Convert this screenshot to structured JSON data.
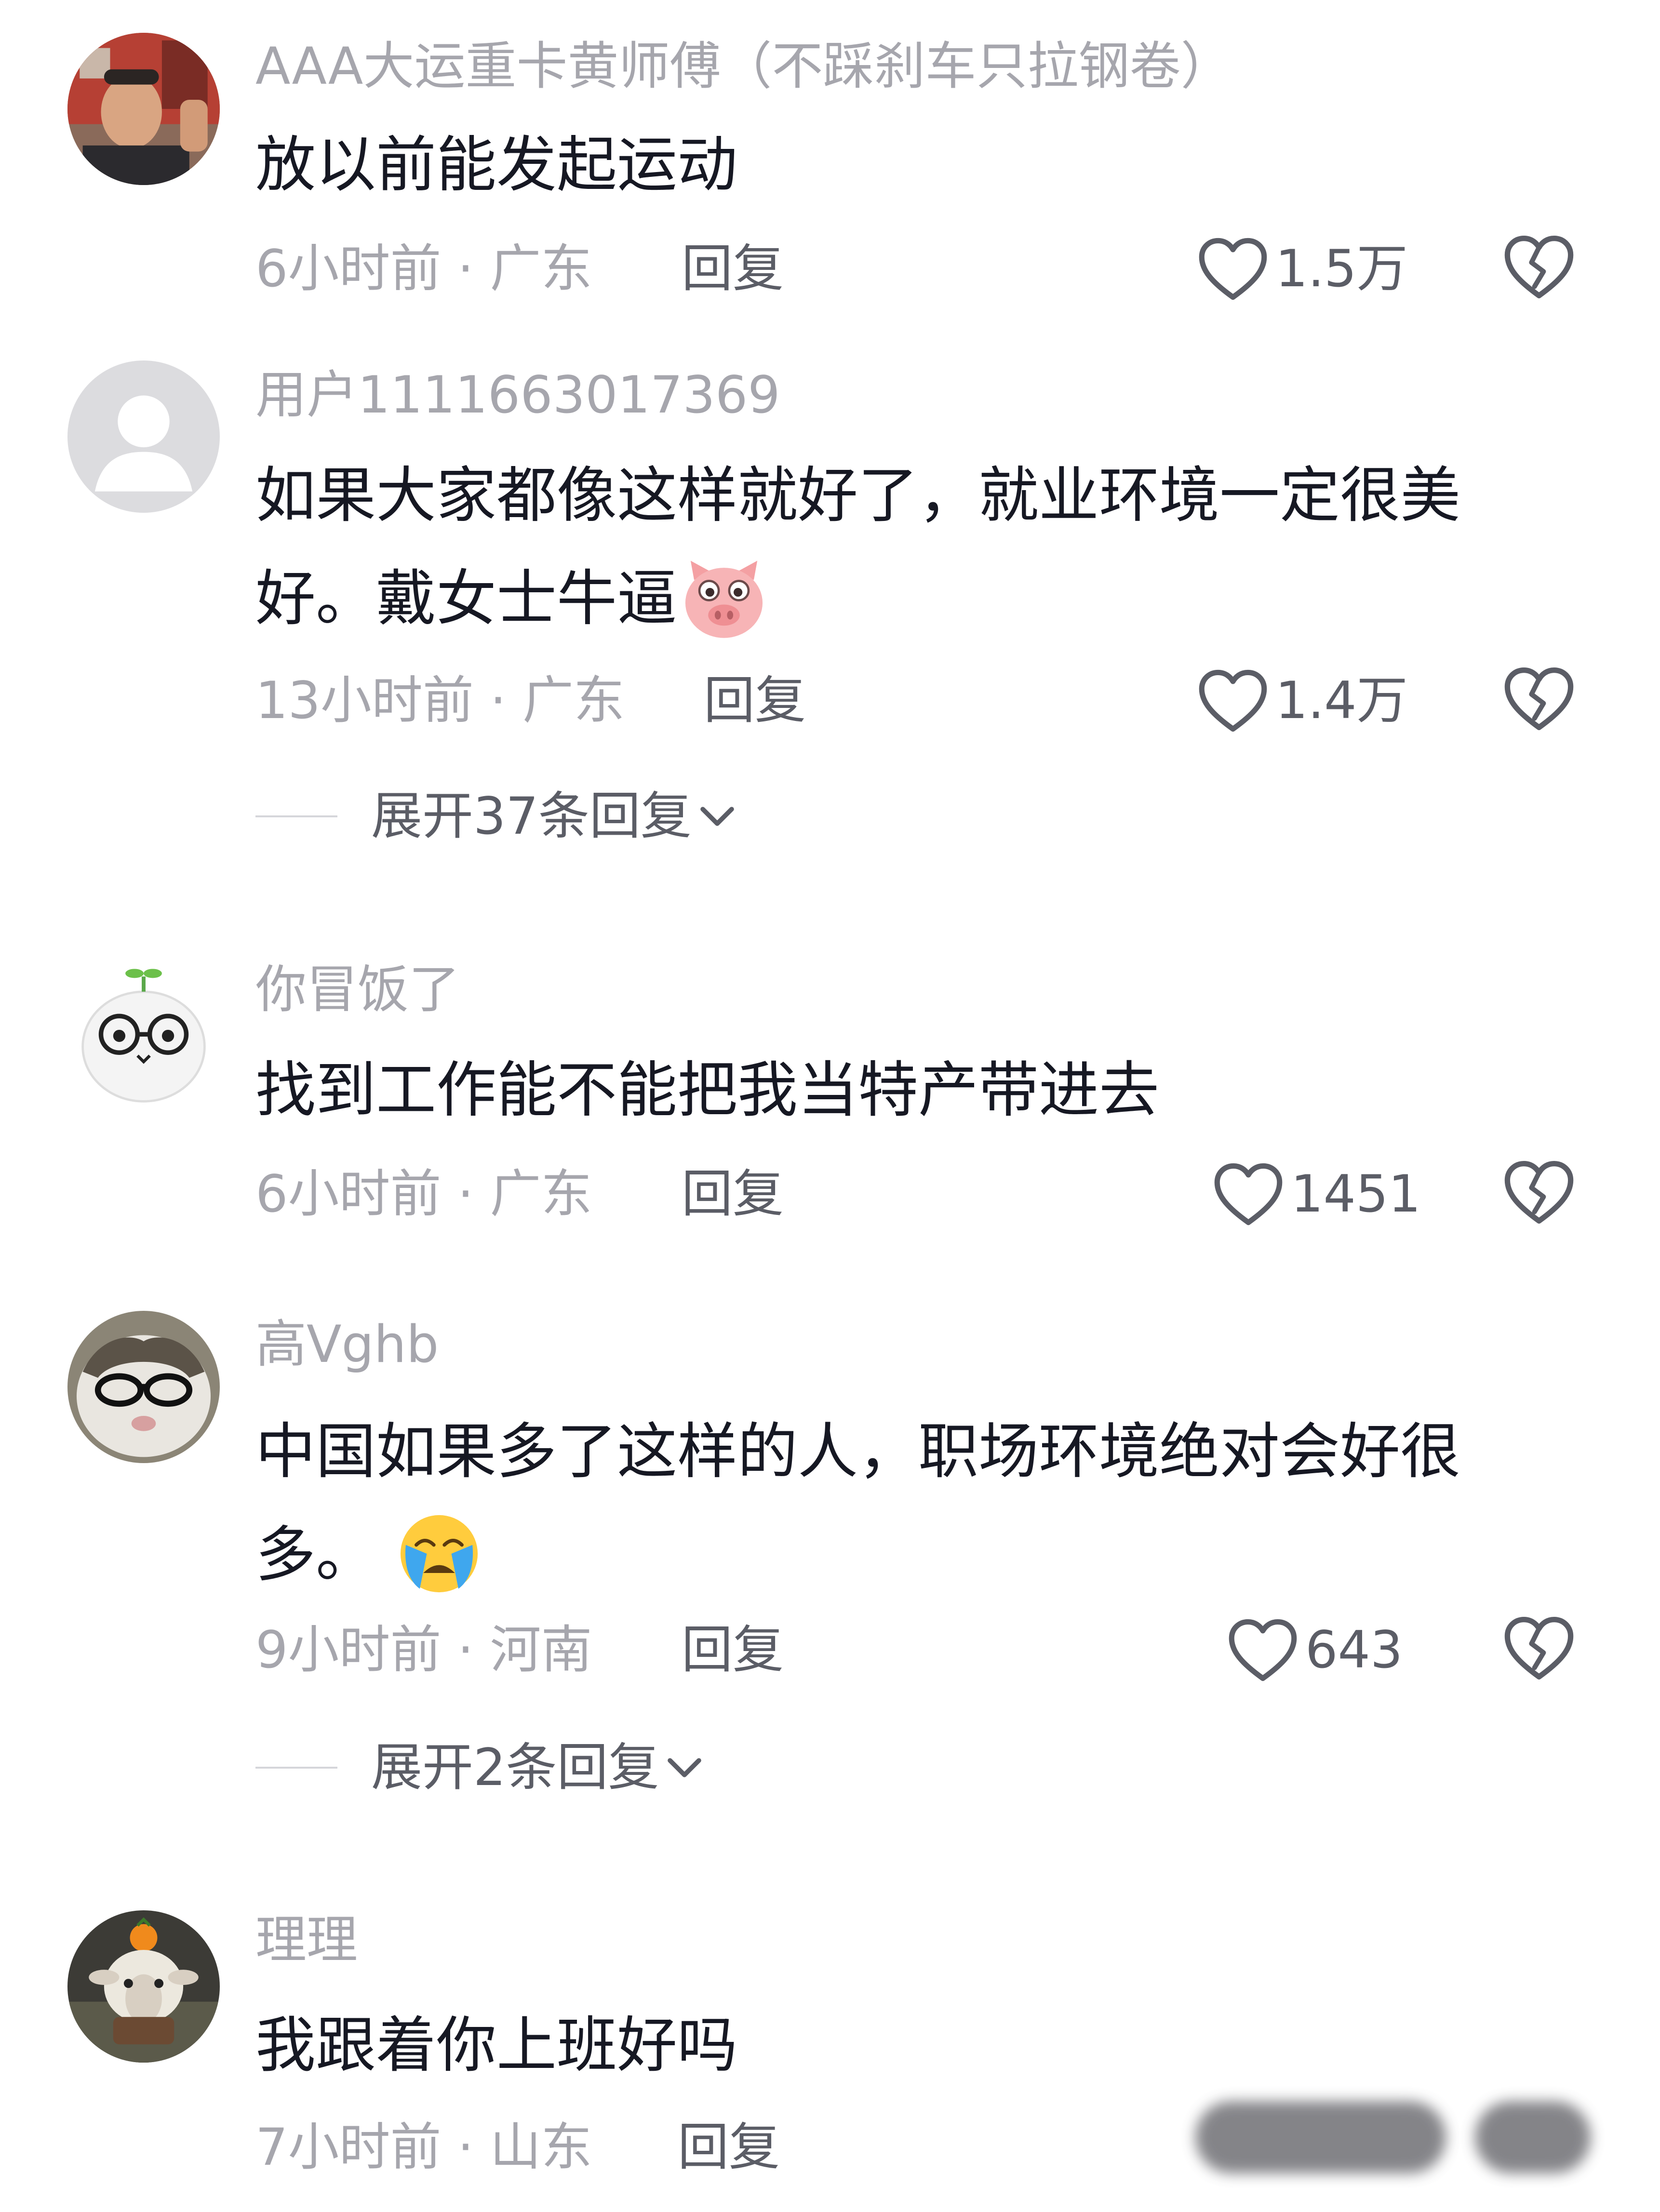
{
  "comments": [
    {
      "username": "AAA大运重卡黄师傅（不踩刹车只拉钢卷）",
      "text_lines": [
        "放以前能发起运动"
      ],
      "meta": "6小时前 · 广东",
      "reply_label": "回复",
      "likes": "1.5万",
      "avatar_icon": "truck-driver-photo-avatar"
    },
    {
      "username": "用户1111663017369",
      "text_lines": [
        "如果大家都像这样就好了，就业环境一定很美",
        "好。戴女士牛逼"
      ],
      "emoji": "pig-emoji",
      "meta": "13小时前 · 广东",
      "reply_label": "回复",
      "likes": "1.4万",
      "expand_label": "展开37条回复",
      "avatar_icon": "default-user-avatar"
    },
    {
      "username": "你冒饭了",
      "text_lines": [
        "找到工作能不能把我当特产带进去"
      ],
      "meta": "6小时前 · 广东",
      "reply_label": "回复",
      "likes": "1451",
      "avatar_icon": "cartoon-glasses-avatar"
    },
    {
      "username": "高Vghb",
      "text_lines": [
        "中国如果多了这样的人，职场环境绝对会好很",
        "多。"
      ],
      "emoji": "crying-face-emoji",
      "meta": "9小时前 · 河南",
      "reply_label": "回复",
      "likes": "643",
      "expand_label": "展开2条回复",
      "avatar_icon": "cat-with-glasses-avatar"
    },
    {
      "username": "理理",
      "text_lines": [
        "我跟着你上班好吗"
      ],
      "meta": "7小时前 · 山东",
      "reply_label": "回复",
      "avatar_icon": "sheep-with-orange-avatar"
    }
  ],
  "colors": {
    "text_primary": "#161823",
    "text_secondary": "#a6a6ad",
    "action_text": "#5b5d66"
  }
}
